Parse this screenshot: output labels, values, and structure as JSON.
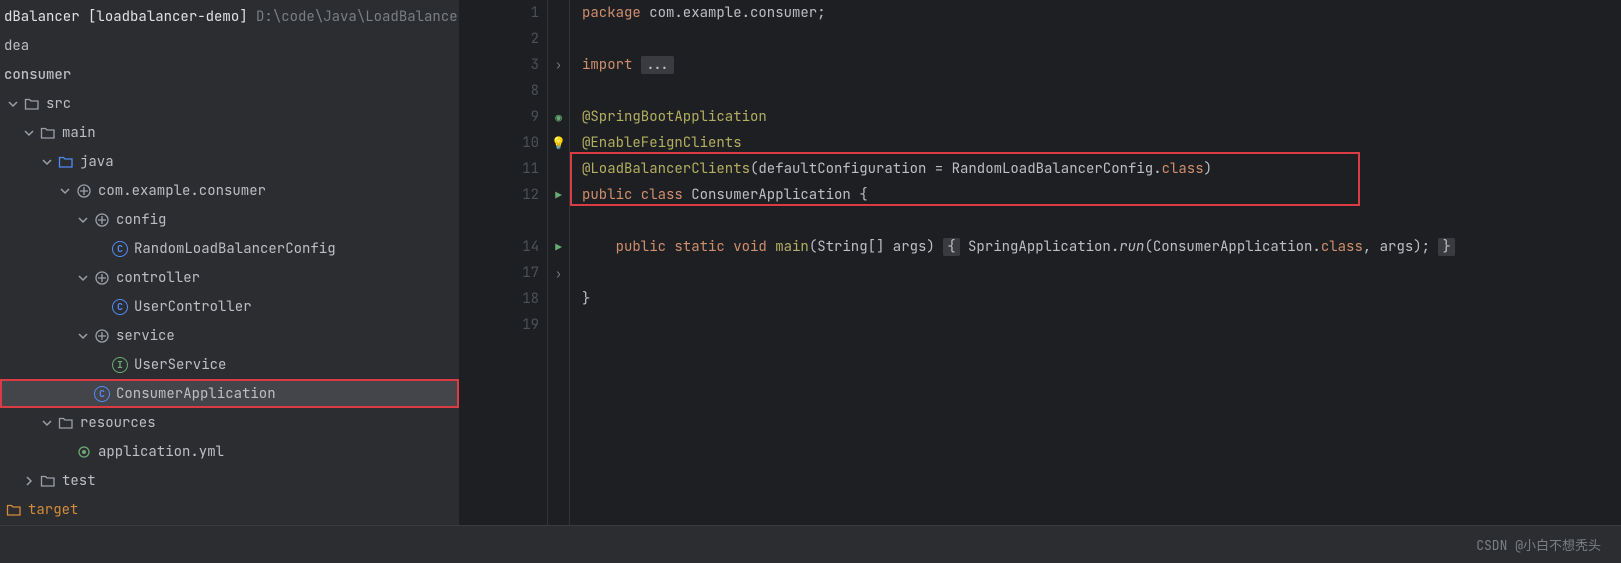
{
  "project": {
    "name_prefix": "dBalancer",
    "name_bracket": "[loadbalancer-demo]",
    "path": "D:\\code\\Java\\LoadBalance"
  },
  "tree": {
    "n0": "dea",
    "n1": "consumer",
    "n2": "src",
    "n3": "main",
    "n4": "java",
    "n5": "com.example.consumer",
    "n6": "config",
    "n7": "RandomLoadBalancerConfig",
    "n8": "controller",
    "n9": "UserController",
    "n10": "service",
    "n11": "UserService",
    "n12": "ConsumerApplication",
    "n13": "resources",
    "n14": "application.yml",
    "n15": "test",
    "n16": "target"
  },
  "gutter": [
    "1",
    "2",
    "3",
    "8",
    "9",
    "10",
    "11",
    "12",
    "",
    "14",
    "17",
    "18",
    "19"
  ],
  "code": {
    "l1_kw": "package",
    "l1_rest": " com.example.consumer;",
    "l3_kw": "import",
    "l3_fold": "...",
    "l9": "@SpringBootApplication",
    "l10": "@EnableFeignClients",
    "l11_ann": "@LoadBalancerClients",
    "l11_args_a": "(defaultConfiguration = RandomLoadBalancerConfig.",
    "l11_args_class": "class",
    "l11_args_b": ")",
    "l12_a": "public class",
    "l12_b": " ConsumerApplication {",
    "l14_a": "public static void",
    "l14_main": " main",
    "l14_args": "(String[] args) ",
    "l14_brace1": "{",
    "l14_mid_a": " SpringApplication.",
    "l14_run": "run",
    "l14_mid_b": "(ConsumerApplication.",
    "l14_class": "class",
    "l14_end": ", args); ",
    "l14_brace2": "}",
    "l18": "}"
  },
  "watermark": "CSDN @小白不想秃头"
}
